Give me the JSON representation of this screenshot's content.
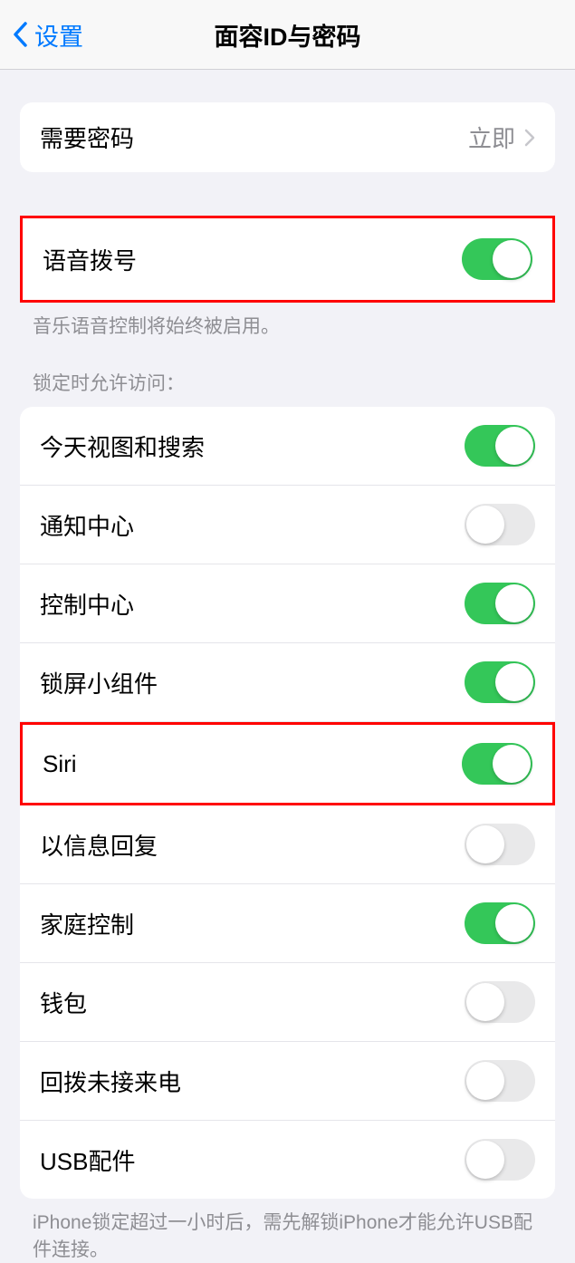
{
  "nav": {
    "back_label": "设置",
    "title": "面容ID与密码"
  },
  "passcode_section": {
    "require_passcode_label": "需要密码",
    "require_passcode_value": "立即"
  },
  "voice_dial": {
    "label": "语音拨号",
    "enabled": true,
    "footer": "音乐语音控制将始终被启用。"
  },
  "lock_access": {
    "header": "锁定时允许访问：",
    "items": [
      {
        "label": "今天视图和搜索",
        "enabled": true,
        "highlighted": false
      },
      {
        "label": "通知中心",
        "enabled": false,
        "highlighted": false
      },
      {
        "label": "控制中心",
        "enabled": true,
        "highlighted": false
      },
      {
        "label": "锁屏小组件",
        "enabled": true,
        "highlighted": false
      },
      {
        "label": "Siri",
        "enabled": true,
        "highlighted": true
      },
      {
        "label": "以信息回复",
        "enabled": false,
        "highlighted": false
      },
      {
        "label": "家庭控制",
        "enabled": true,
        "highlighted": false
      },
      {
        "label": "钱包",
        "enabled": false,
        "highlighted": false
      },
      {
        "label": "回拨未接来电",
        "enabled": false,
        "highlighted": false
      },
      {
        "label": "USB配件",
        "enabled": false,
        "highlighted": false
      }
    ],
    "footer": "iPhone锁定超过一小时后，需先解锁iPhone才能允许USB配件连接。"
  }
}
